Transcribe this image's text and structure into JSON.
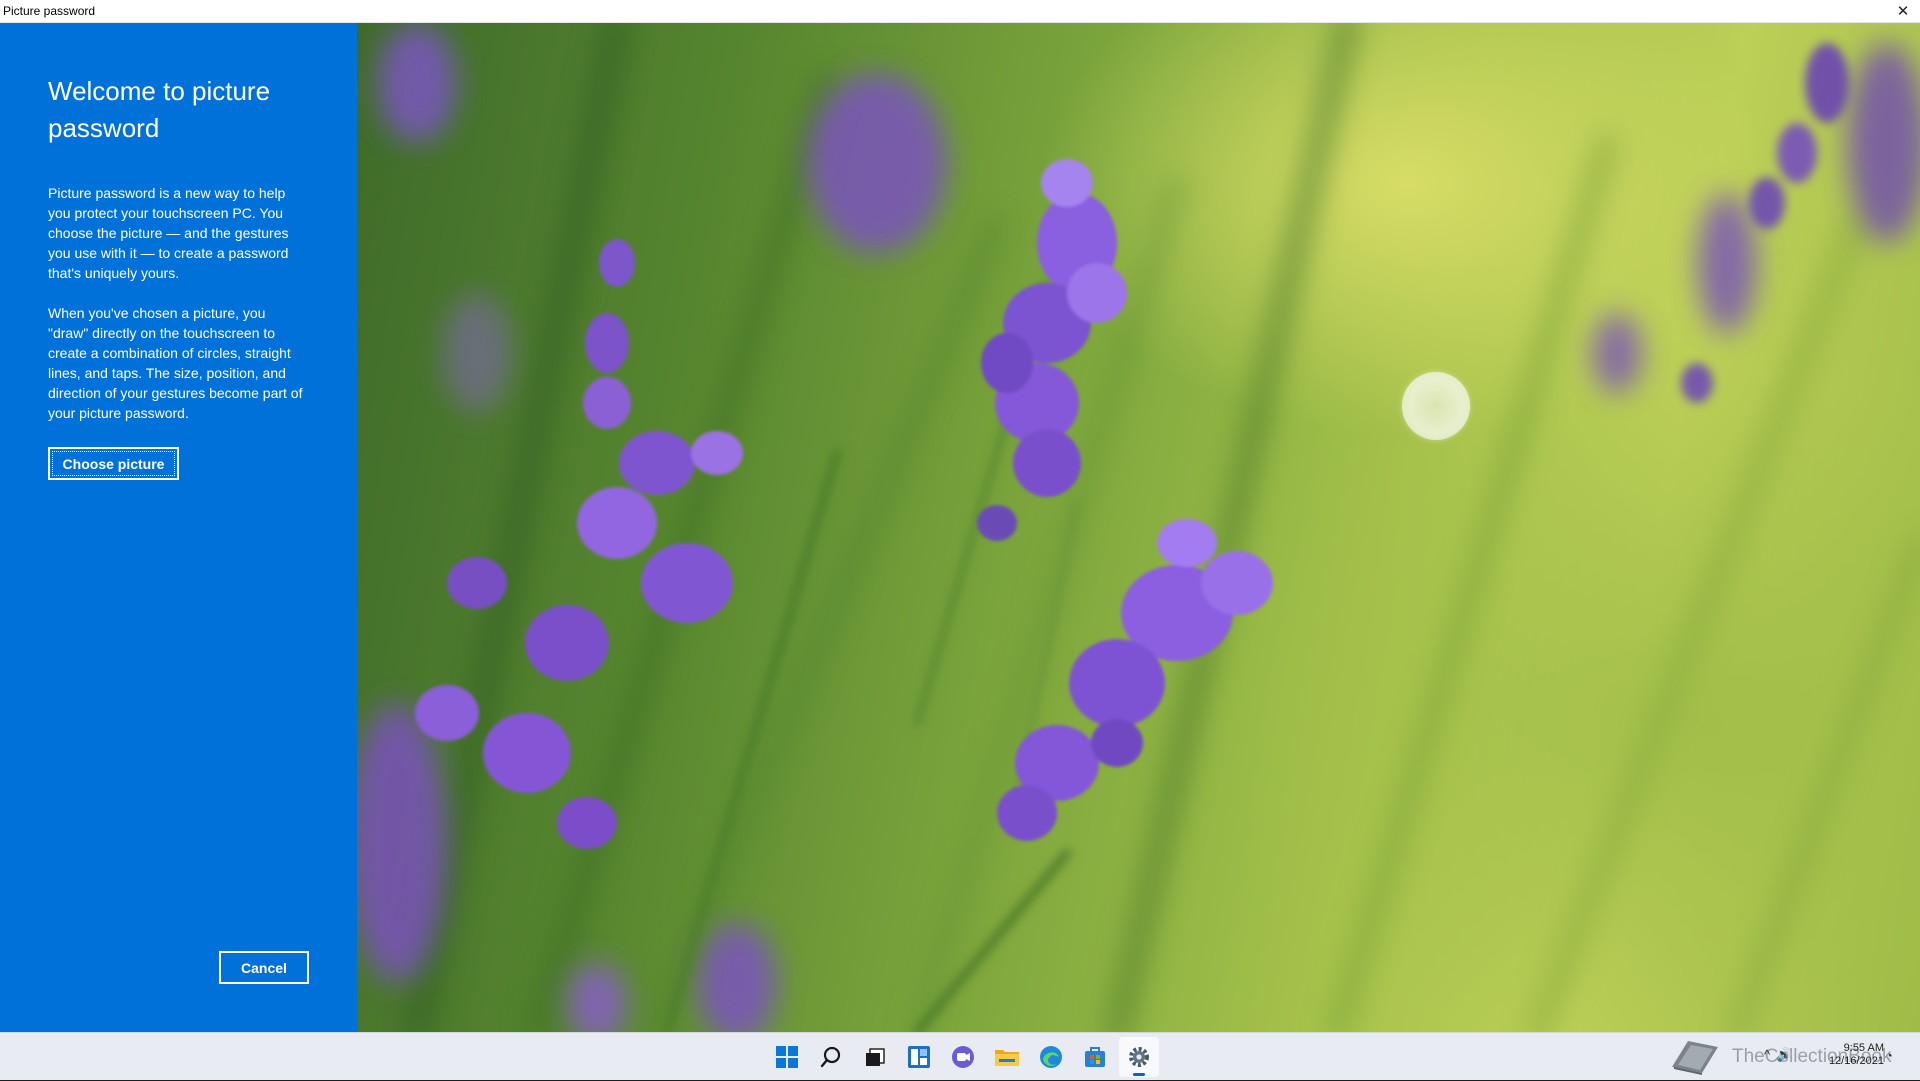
{
  "window": {
    "title": "Picture password",
    "close_glyph": "✕"
  },
  "panel": {
    "heading": "Welcome to picture password",
    "paragraph1": "Picture password is a new way to help you protect your touchscreen PC. You choose the picture — and the gestures you use with it — to create a password that's uniquely yours.",
    "paragraph2": "When you've chosen a picture, you \"draw\" directly on the touchscreen to create a combination of circles, straight lines, and taps. The size, position, and direction of your gestures become part of your picture password.",
    "choose_button": "Choose picture",
    "cancel_button": "Cancel",
    "background_color": "#0071d8"
  },
  "picture": {
    "subject": "lavender-flowers-photo"
  },
  "taskbar": {
    "icons": [
      "windows-start-icon",
      "search-icon",
      "task-view-icon",
      "widgets-icon",
      "chat-icon",
      "file-explorer-icon",
      "edge-browser-icon",
      "store-icon",
      "settings-icon"
    ],
    "active_icon": "settings-icon",
    "watermark_text": "TheCollectionBook",
    "clock_time": "9:55 AM",
    "clock_date": "12/16/2021"
  }
}
